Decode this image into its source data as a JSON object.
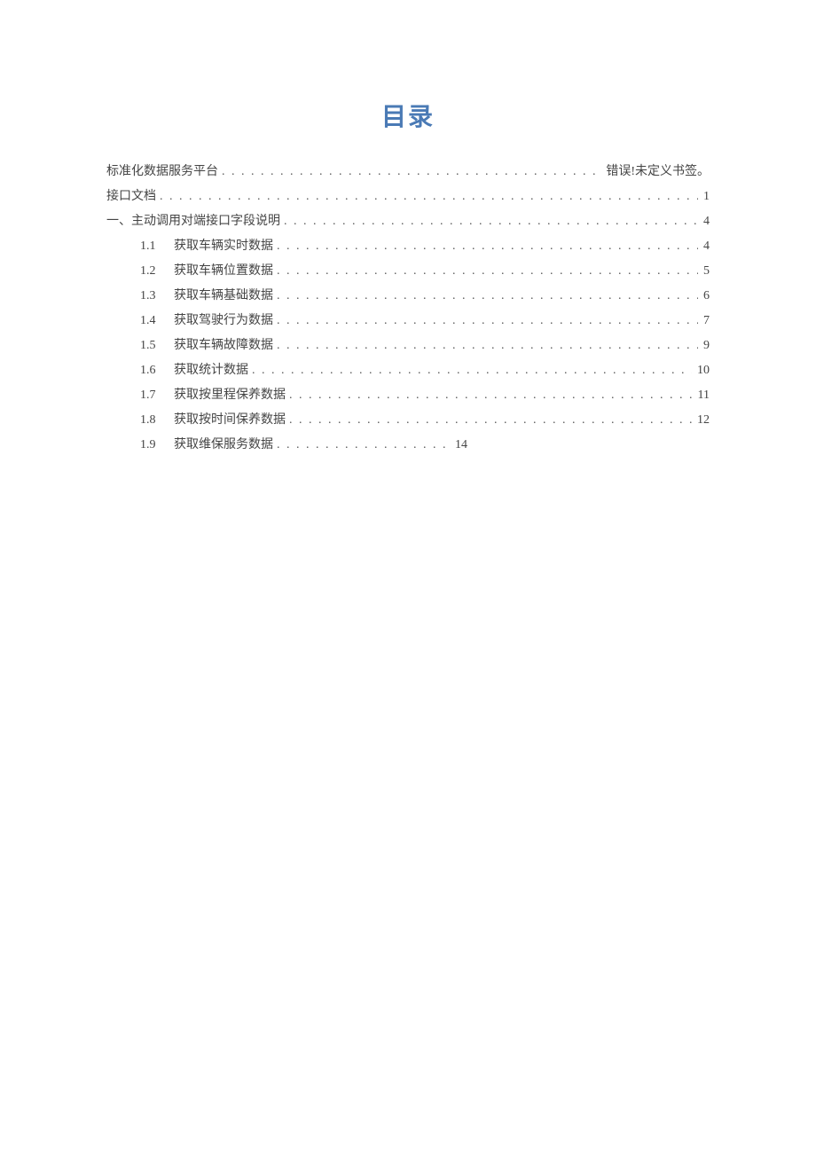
{
  "title": "目录",
  "entries": [
    {
      "level": 1,
      "num": "",
      "label": "标准化数据服务平台",
      "page": "错误!未定义书签。",
      "short": false
    },
    {
      "level": 1,
      "num": "",
      "label": "接口文档",
      "page": "1",
      "short": false
    },
    {
      "level": 1,
      "num": "",
      "label": "一、主动调用对端接口字段说明",
      "page": "4",
      "short": false
    },
    {
      "level": 2,
      "num": "1.1",
      "label": "获取车辆实时数据",
      "page": "4",
      "short": false
    },
    {
      "level": 2,
      "num": "1.2",
      "label": "获取车辆位置数据",
      "page": "5",
      "short": false
    },
    {
      "level": 2,
      "num": "1.3",
      "label": "获取车辆基础数据",
      "page": "6",
      "short": false
    },
    {
      "level": 2,
      "num": "1.4",
      "label": "获取驾驶行为数据",
      "page": "7",
      "short": false
    },
    {
      "level": 2,
      "num": "1.5",
      "label": "获取车辆故障数据",
      "page": "9",
      "short": false
    },
    {
      "level": 2,
      "num": "1.6",
      "label": "获取统计数据",
      "page": "10",
      "short": false
    },
    {
      "level": 2,
      "num": "1.7",
      "label": "获取按里程保养数据",
      "page": "11",
      "short": false
    },
    {
      "level": 2,
      "num": "1.8",
      "label": "获取按时间保养数据",
      "page": "12",
      "short": false
    },
    {
      "level": 2,
      "num": "1.9",
      "label": "获取维保服务数据",
      "page": "14",
      "short": true
    }
  ]
}
